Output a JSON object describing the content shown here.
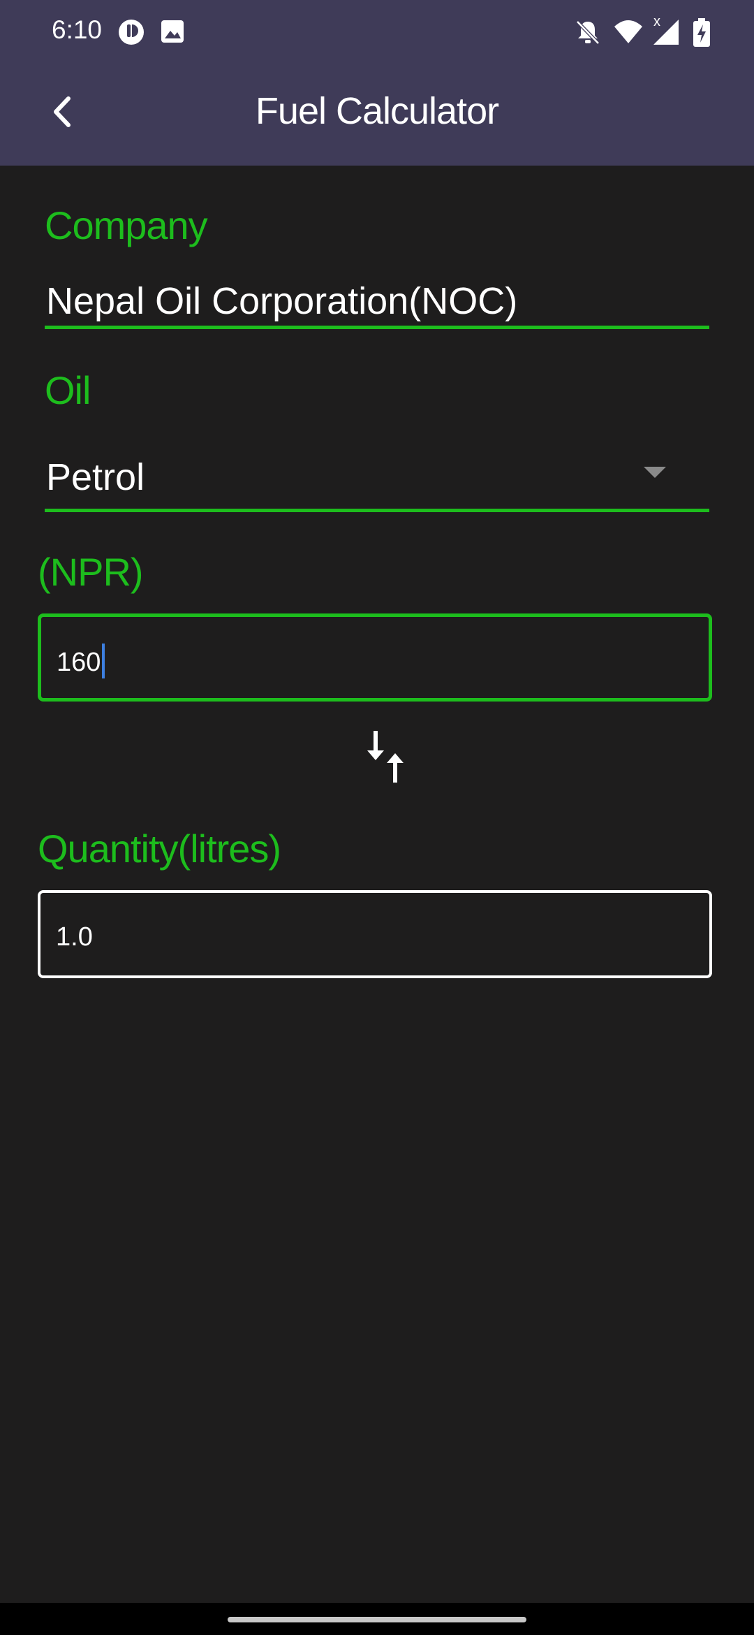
{
  "status_bar": {
    "time": "6:10",
    "icons": [
      "app-notification-icon",
      "image-icon",
      "bell-off-icon",
      "wifi-icon",
      "signal-icon",
      "battery-charging-icon"
    ]
  },
  "app_bar": {
    "title": "Fuel Calculator",
    "back_icon": "chevron-left-icon"
  },
  "form": {
    "company": {
      "label": "Company",
      "value": "Nepal Oil Corporation(NOC)"
    },
    "oil": {
      "label": "Oil",
      "selected": "Petrol"
    },
    "npr": {
      "label": "(NPR)",
      "value": "160"
    },
    "swap_icon": "swap-vertical-icon",
    "quantity": {
      "label": "Quantity(litres)",
      "value": "1.0"
    }
  },
  "colors": {
    "accent": "#1dbd1d",
    "app_bar": "#3f3b58",
    "background": "#1e1d1d",
    "caret": "#3d7fe0"
  }
}
